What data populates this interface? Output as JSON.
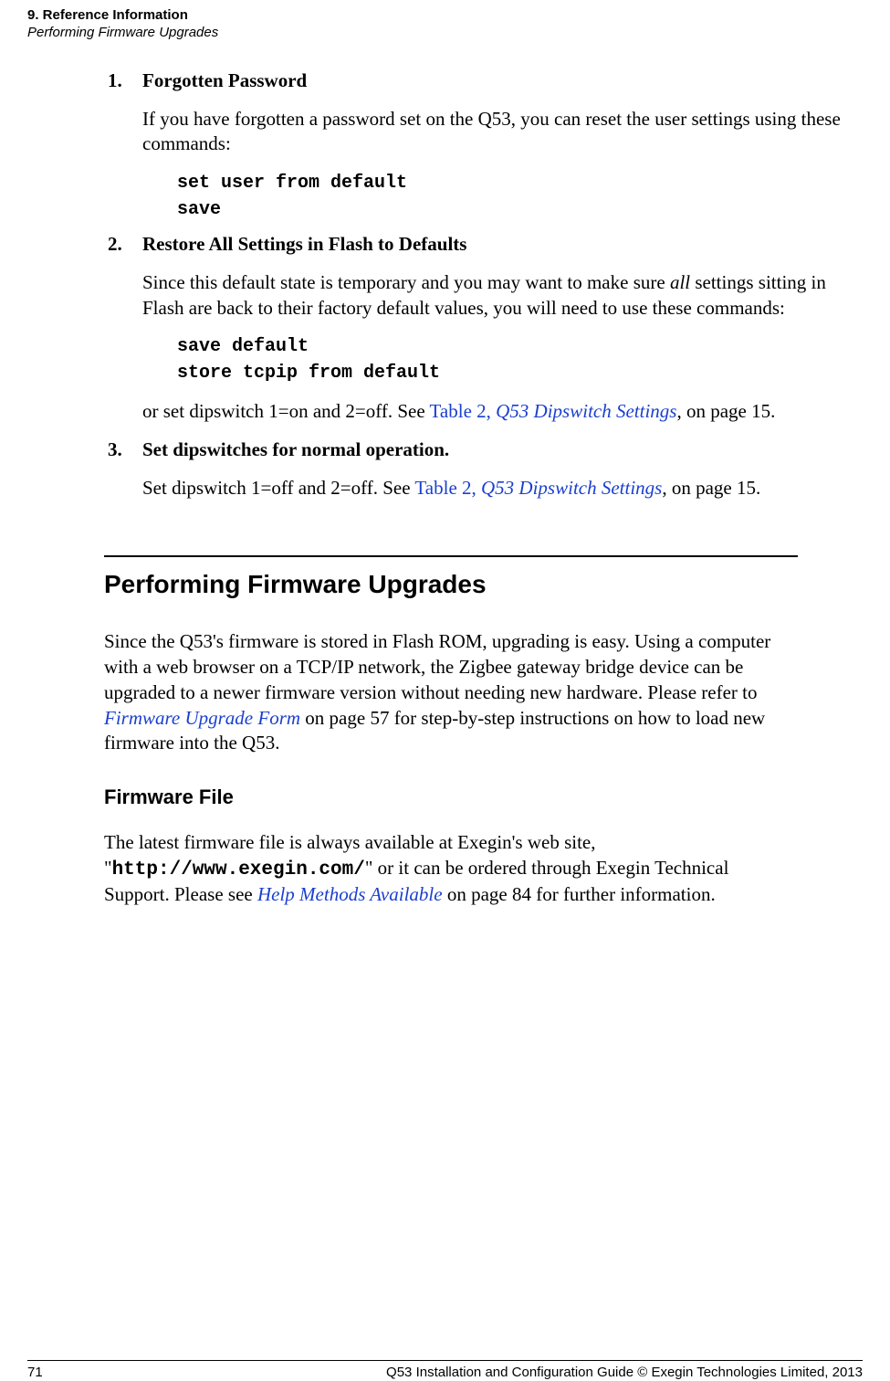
{
  "header": {
    "chapter": "9. Reference Information",
    "section": "Performing Firmware Upgrades"
  },
  "items": [
    {
      "num": "1.",
      "title": "Forgotten Password",
      "body": "If you have forgotten a password set on the Q53, you can reset the user settings using these commands:",
      "code1": "set user from default",
      "code2": "save"
    },
    {
      "num": "2.",
      "title": "Restore All Settings in Flash to Defaults",
      "body_lead": "Since this default state is temporary and you may want to make sure ",
      "body_em": "all",
      "body_tail": " settings sitting in Flash are back to their factory default values, you will need to use these commands:",
      "code1": "save default",
      "code2": "store tcpip from default",
      "tail_pre": "or set dipswitch 1=on and 2=off. See ",
      "tail_link_a": "Table 2, ",
      "tail_link_b": "Q53 Dipswitch Settings",
      "tail_post": ", on page 15."
    },
    {
      "num": "3.",
      "title": "Set dipswitches for normal operation.",
      "tail_pre": "Set dipswitch 1=off and 2=off. See ",
      "tail_link_a": "Table 2, ",
      "tail_link_b": "Q53 Dipswitch Settings",
      "tail_post": ", on page 15."
    }
  ],
  "h2": "Performing Firmware Upgrades",
  "para1_a": "Since the Q53's firmware is stored in Flash ROM, upgrading is easy. Using a computer with a web browser on a TCP/IP network, the Zigbee gateway bridge device can be upgraded to a newer firmware version without needing new hardware. Please refer to ",
  "para1_link": "Firmware Upgrade Form",
  "para1_b": " on page 57 for step-by-step instructions on how to load new firmware into the Q53.",
  "h3": "Firmware File",
  "para2_a": "The latest firmware file is always available at Exegin's web site, \"",
  "para2_url": "http://www.exegin.com/",
  "para2_b": "\" or it can be ordered through Exegin Technical Support. Please see ",
  "para2_link": "Help Methods Available",
  "para2_c": " on page 84 for further information.",
  "footer": {
    "page": "71",
    "text": "Q53 Installation and Configuration Guide  © Exegin Technologies Limited, 2013"
  }
}
